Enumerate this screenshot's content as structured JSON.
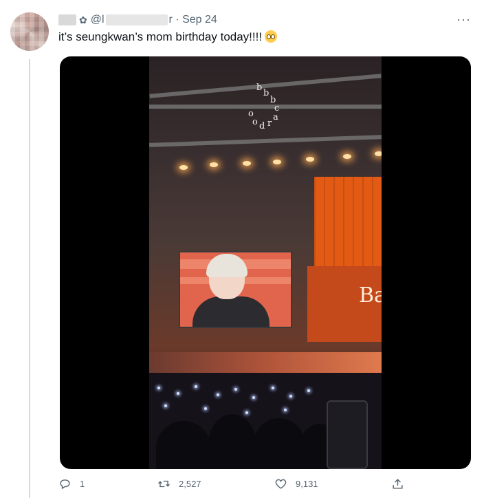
{
  "tweet": {
    "author_name_suffix": "r",
    "handle_prefix": "@l",
    "handle_suffix": "r",
    "date": "Sep 24",
    "flower_glyph": "✿",
    "text": "it’s seungkwan’s mom birthday today!!!!",
    "emoji_icon": "pleading-face-icon",
    "more_label": "···"
  },
  "media": {
    "type": "video",
    "watermark_letters": [
      "b",
      "b",
      "b",
      "c",
      "a",
      "r",
      "d",
      "o",
      "o"
    ],
    "stage_sign_letters": "Ba"
  },
  "actions": {
    "reply": {
      "icon": "reply-icon",
      "count": "1"
    },
    "retweet": {
      "icon": "retweet-icon",
      "count": "2,527"
    },
    "like": {
      "icon": "heart-icon",
      "count": "9,131"
    },
    "share": {
      "icon": "share-icon"
    }
  },
  "colors": {
    "text_primary": "#0f1419",
    "text_secondary": "#536471",
    "thread_line": "#cfd9de",
    "media_bg": "#000000"
  }
}
